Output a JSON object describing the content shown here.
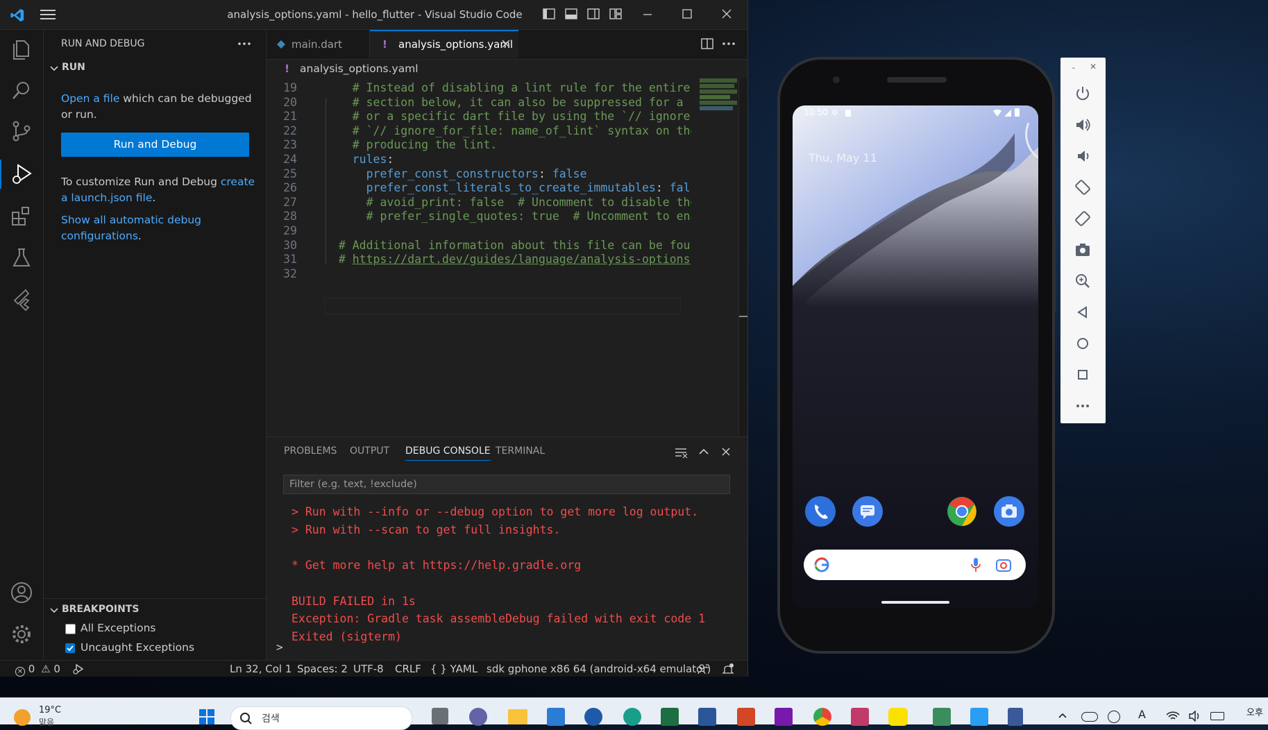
{
  "window": {
    "title": "analysis_options.yaml - hello_flutter - Visual Studio Code"
  },
  "sidebar": {
    "header": "RUN AND DEBUG",
    "section": "RUN",
    "open_link": "Open a file",
    "open_rest": " which can be debugged",
    "open_rest2": "or run.",
    "run_button": "Run and Debug",
    "customize_text": "To customize Run and Debug ",
    "customize_link1": "create",
    "customize_link2": "a launch.json file",
    "customize_end": ".",
    "show_link1": "Show all automatic debug",
    "show_link2": "configurations",
    "show_end": ".",
    "breakpoints_header": "BREAKPOINTS",
    "breakpoints": [
      {
        "label": "All Exceptions",
        "checked": false
      },
      {
        "label": "Uncaught Exceptions",
        "checked": true
      }
    ]
  },
  "editor": {
    "tabs": [
      {
        "label": "main.dart",
        "active": false
      },
      {
        "label": "analysis_options.yaml",
        "active": true
      }
    ],
    "breadcrumb": "analysis_options.yaml",
    "lines": [
      {
        "n": "19",
        "parts": [
          {
            "t": "    # Instead of disabling a lint rule for the entire pro",
            "c": "cmt"
          }
        ]
      },
      {
        "n": "20",
        "parts": [
          {
            "t": "    # section below, it can also be suppressed for a sing",
            "c": "cmt"
          }
        ]
      },
      {
        "n": "21",
        "parts": [
          {
            "t": "    # or a specific dart file by using the `// ignore: na",
            "c": "cmt"
          }
        ]
      },
      {
        "n": "22",
        "parts": [
          {
            "t": "    # `// ignore_for_file: name_of_lint` syntax on the li",
            "c": "cmt"
          }
        ]
      },
      {
        "n": "23",
        "parts": [
          {
            "t": "    # producing the lint.",
            "c": "cmt"
          }
        ]
      },
      {
        "n": "24",
        "parts": [
          {
            "t": "    ",
            "c": ""
          },
          {
            "t": "rules",
            "c": "key"
          },
          {
            "t": ":",
            "c": ""
          }
        ]
      },
      {
        "n": "25",
        "parts": [
          {
            "t": "      ",
            "c": ""
          },
          {
            "t": "prefer_const_constructors",
            "c": "key"
          },
          {
            "t": ": ",
            "c": ""
          },
          {
            "t": "false",
            "c": "bool"
          }
        ]
      },
      {
        "n": "26",
        "parts": [
          {
            "t": "      ",
            "c": ""
          },
          {
            "t": "prefer_const_literals_to_create_immutables",
            "c": "key"
          },
          {
            "t": ": ",
            "c": ""
          },
          {
            "t": "false",
            "c": "bool"
          }
        ]
      },
      {
        "n": "27",
        "parts": [
          {
            "t": "      # avoid_print: false  # Uncomment to disable the `a",
            "c": "cmt"
          }
        ]
      },
      {
        "n": "28",
        "parts": [
          {
            "t": "      # prefer_single_quotes: true  # Uncomment to enable",
            "c": "cmt"
          }
        ]
      },
      {
        "n": "29",
        "parts": [
          {
            "t": "",
            "c": ""
          }
        ]
      },
      {
        "n": "30",
        "parts": [
          {
            "t": "  # Additional information about this file can be found a",
            "c": "cmt"
          }
        ]
      },
      {
        "n": "31",
        "parts": [
          {
            "t": "  # ",
            "c": "cmt"
          },
          {
            "t": "https://dart.dev/guides/language/analysis-options",
            "c": "lnk"
          }
        ]
      },
      {
        "n": "32",
        "parts": [
          {
            "t": "",
            "c": ""
          }
        ]
      }
    ]
  },
  "panel": {
    "tabs": [
      "PROBLEMS",
      "OUTPUT",
      "DEBUG CONSOLE",
      "TERMINAL"
    ],
    "active_tab": "DEBUG CONSOLE",
    "filter_placeholder": "Filter (e.g. text, !exclude)",
    "console": [
      "> Run with --info or --debug option to get more log output.",
      "> Run with --scan to get full insights.",
      "",
      "* Get more help at https://help.gradle.org",
      "",
      "BUILD FAILED in 1s",
      "Exception: Gradle task assembleDebug failed with exit code 1",
      "Exited (sigterm)"
    ],
    "prompt": ">"
  },
  "statusbar": {
    "errors": "0",
    "warnings": "0",
    "position": "Ln 32, Col 1",
    "spaces": "Spaces: 2",
    "encoding": "UTF-8",
    "eol": "CRLF",
    "language": "{ } YAML",
    "device": "sdk gphone x86 64 (android-x64 emulator)"
  },
  "phone": {
    "time": "10:50",
    "date": "Thu, May 11"
  },
  "taskbar": {
    "weather_temp": "19°C",
    "weather_cond": "맑음",
    "search": "검색",
    "clock": "오후"
  },
  "colors": {
    "accent": "#0078d4",
    "link": "#4daafc",
    "error": "#f14c4c",
    "comment": "#6a9955",
    "keyword": "#569cd6"
  }
}
